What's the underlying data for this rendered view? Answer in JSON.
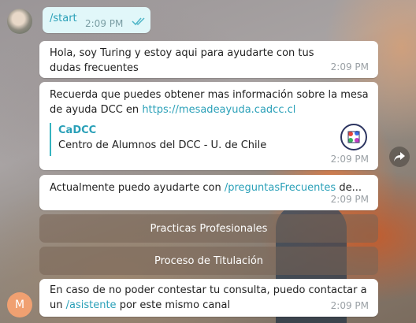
{
  "messages": {
    "outgoing": {
      "text": "/start",
      "time": "2:09 PM"
    },
    "greeting": {
      "text": "Hola, soy Turing y estoy aqui para ayudarte con tus dudas frecuentes",
      "time": "2:09 PM"
    },
    "info": {
      "text_before": "Recuerda que puedes obtener mas información sobre la mesa de ayuda DCC en ",
      "link": "https://mesadeayuda.cadcc.cl",
      "preview_title": "CaDCC",
      "preview_desc": "Centro de Alumnos del DCC - U. de Chile",
      "time": "2:09 PM"
    },
    "current": {
      "text_before": "Actualmente puedo ayudarte con ",
      "command": "/preguntasFrecuentes",
      "text_after": " de...",
      "time": "2:09 PM"
    },
    "final": {
      "text_before": "En caso de no poder contestar tu consulta, puedo contactar a un ",
      "command": "/asistente",
      "text_after": " por este mismo canal",
      "time": "2:09 PM"
    }
  },
  "keyboard": {
    "buttons": [
      "Practicas Profesionales",
      "Proceso de Titulación"
    ]
  },
  "user_avatar_letter": "M",
  "colors": {
    "accent": "#2aa0b8",
    "outgoing_bg": "#e1f7f9",
    "check": "#4fb6c8"
  }
}
